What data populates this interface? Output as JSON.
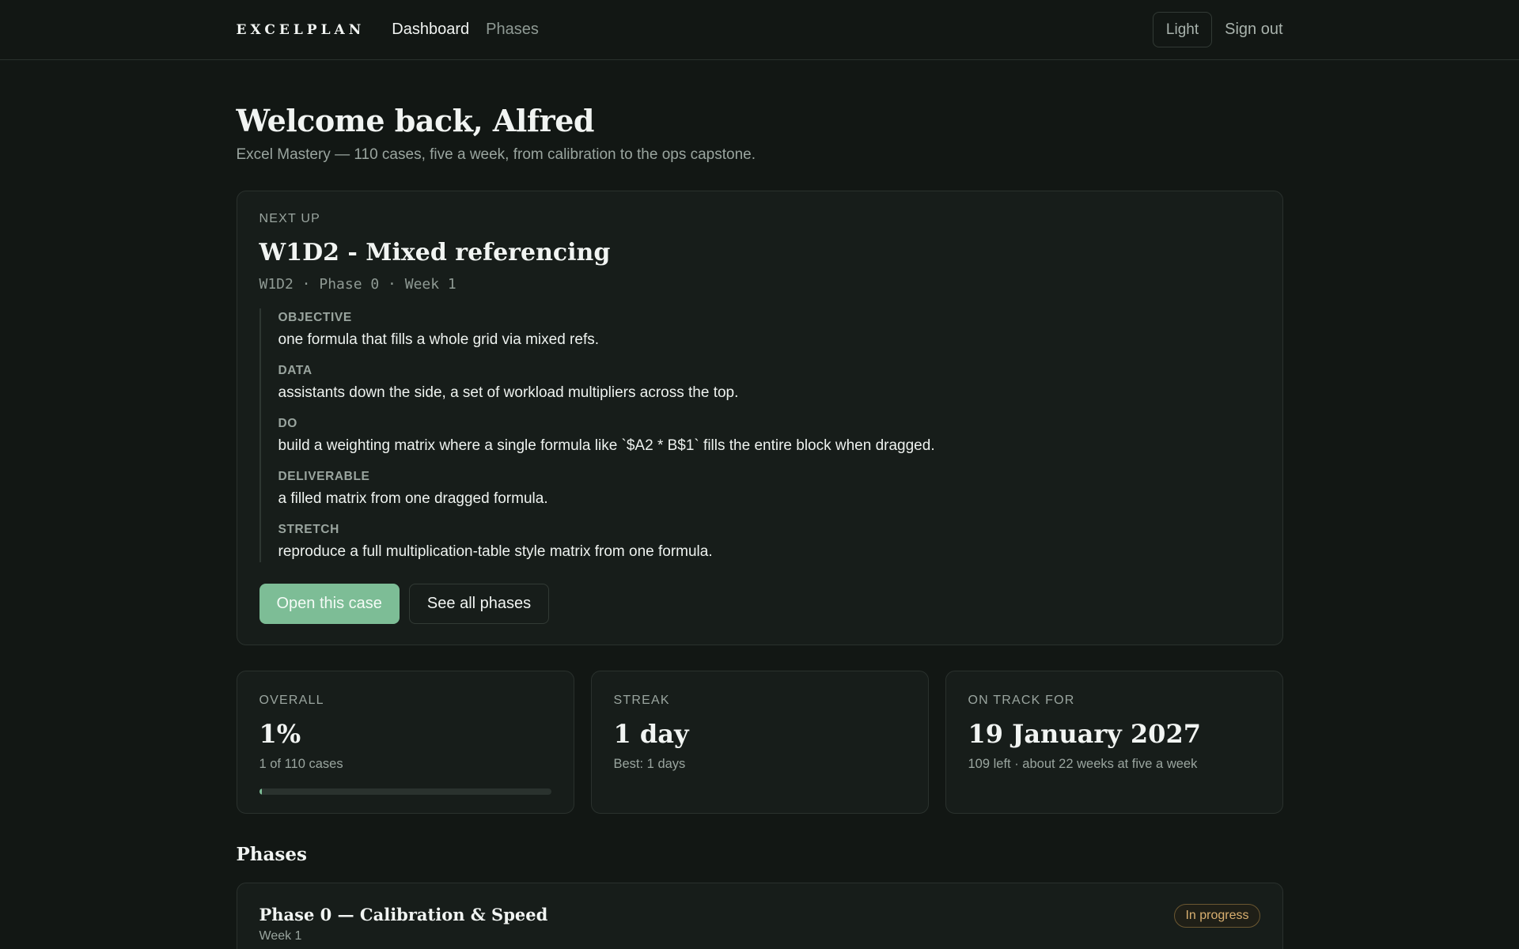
{
  "nav": {
    "brand": "EXCELPLAN",
    "links": [
      {
        "label": "Dashboard",
        "active": true
      },
      {
        "label": "Phases",
        "active": false
      }
    ],
    "theme_toggle": "Light",
    "sign_out": "Sign out"
  },
  "hero": {
    "title": "Welcome back, Alfred",
    "subtitle": "Excel Mastery — 110 cases, five a week, from calibration to the ops capstone."
  },
  "next_up": {
    "eyebrow": "NEXT UP",
    "title": "W1D2 - Mixed referencing",
    "meta": "W1D2 · Phase 0 · Week 1",
    "brief": [
      {
        "label": "OBJECTIVE",
        "text": "one formula that fills a whole grid via mixed refs."
      },
      {
        "label": "DATA",
        "text": "assistants down the side, a set of workload multipliers across the top."
      },
      {
        "label": "DO",
        "text": "build a weighting matrix where a single formula like `$A2 * B$1` fills the entire block when dragged."
      },
      {
        "label": "DELIVERABLE",
        "text": "a filled matrix from one dragged formula."
      },
      {
        "label": "STRETCH",
        "text": "reproduce a full multiplication-table style matrix from one formula."
      }
    ],
    "primary_action": "Open this case",
    "secondary_action": "See all phases"
  },
  "stats": {
    "overall": {
      "label": "OVERALL",
      "value": "1%",
      "sub": "1 of 110 cases",
      "progress_fraction": 0.01
    },
    "streak": {
      "label": "STREAK",
      "value": "1 day",
      "sub": "Best: 1 days"
    },
    "on_track": {
      "label": "ON TRACK FOR",
      "value": "19 January 2027",
      "sub": "109 left · about 22 weeks at five a week"
    }
  },
  "phases": {
    "title": "Phases",
    "items": [
      {
        "title": "Phase 0 — Calibration & Speed",
        "week": "Week 1",
        "status": "In progress"
      }
    ]
  },
  "colors": {
    "background": "#121714",
    "card": "#171d1a",
    "accent": "#7dbd96",
    "badge": "#d9b070"
  }
}
